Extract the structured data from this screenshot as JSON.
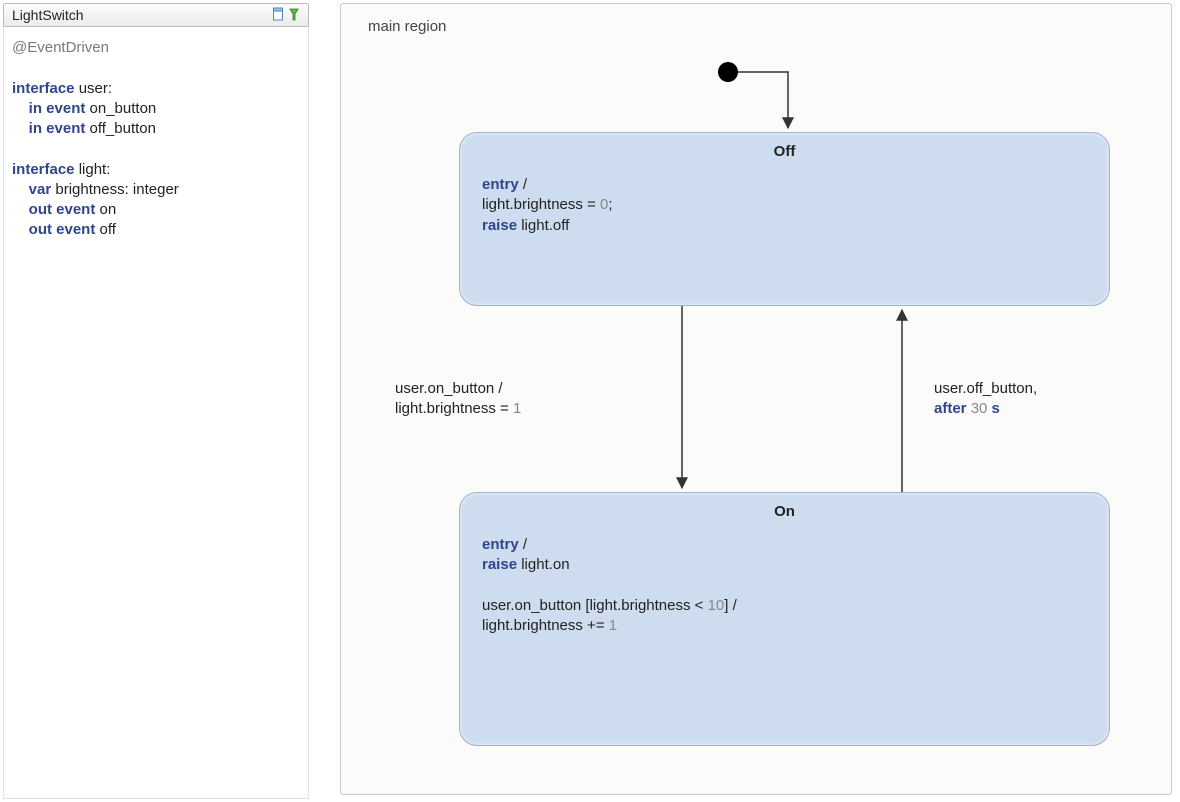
{
  "title": "LightSwitch",
  "definition": {
    "annotation": "@EventDriven",
    "interfaces": [
      {
        "name": "user",
        "lines": [
          "in event on_button",
          "in event off_button"
        ]
      },
      {
        "name": "light",
        "lines": [
          "var brightness: integer",
          "out event on",
          "out event off"
        ]
      }
    ]
  },
  "diagram": {
    "regionLabel": "main region",
    "states": [
      {
        "id": "off",
        "name": "Off",
        "bodyLines": [
          "entry /",
          "light.brightness = 0;",
          "raise light.off"
        ]
      },
      {
        "id": "on",
        "name": "On",
        "bodyLines": [
          "entry /",
          "raise light.on",
          "",
          "user.on_button [light.brightness < 10] /",
          "light.brightness += 1"
        ]
      }
    ],
    "transitions": [
      {
        "id": "init_off",
        "labelLines": []
      },
      {
        "id": "off_on",
        "labelLines": [
          "user.on_button /",
          "light.brightness = 1"
        ]
      },
      {
        "id": "on_off",
        "labelLines": [
          "user.off_button,",
          "after 30 s"
        ]
      }
    ]
  }
}
